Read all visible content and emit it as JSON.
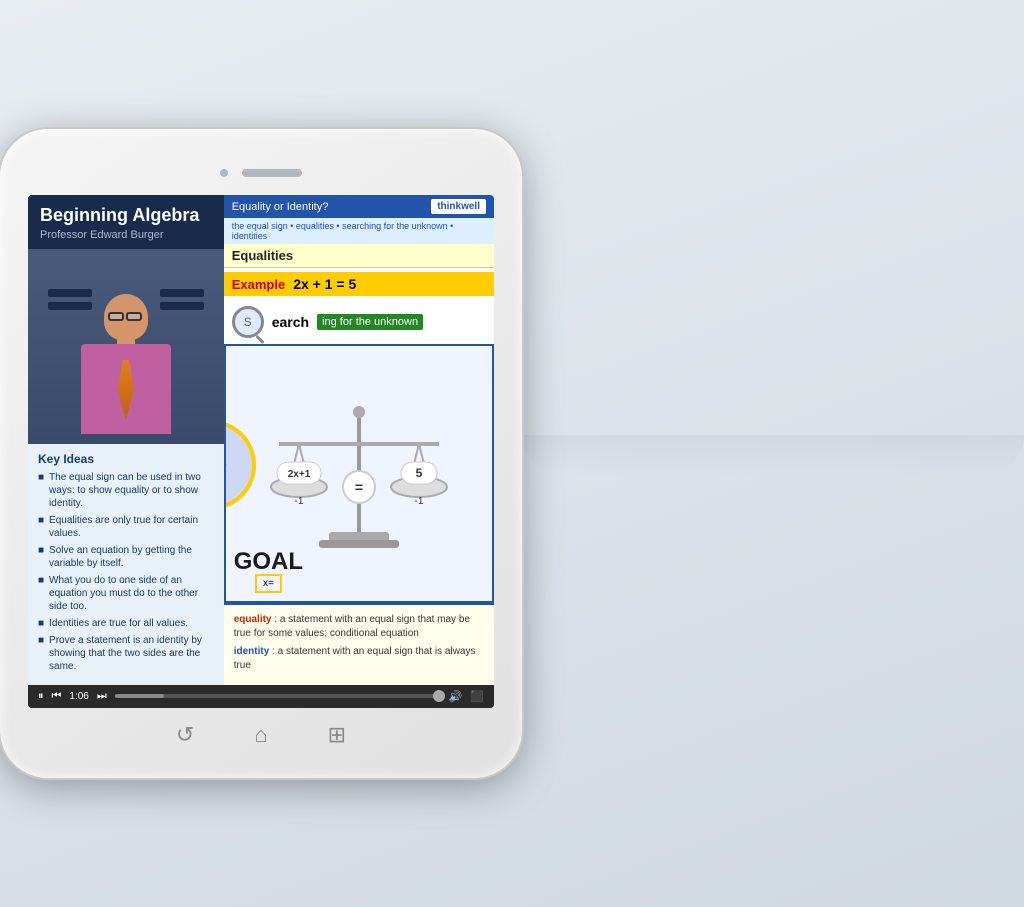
{
  "tablet": {
    "top_bar": {
      "camera_label": "camera",
      "speaker_label": "speaker"
    }
  },
  "left_panel": {
    "title": "Beginning Algebra",
    "subtitle": "Professor Edward Burger",
    "key_ideas_title": "Key Ideas",
    "key_ideas": [
      "The equal sign can be used in two ways: to show equality or to show identity.",
      "Equalities are only true for certain values.",
      "Solve an equation by getting the variable by itself.",
      "What you do to one side of an equation you must do to the other side too.",
      "Identities are true for all values.",
      "Prove a statement is an identity by showing that the two sides are the same."
    ]
  },
  "right_panel": {
    "top_title": "Equality or Identity?",
    "logo": "thinkwell",
    "breadcrumb": "the equal sign  •  equalities  •  searching for the unknown  •  identities",
    "equalities_title": "Equalities",
    "example_label": "Example",
    "example_equation": "2x + 1 = 5",
    "search_text": "Search",
    "search_highlight": "ing for the unknown",
    "goal_text": "GOAL",
    "goal_sub": "x=",
    "scale_left_top": "2x+1",
    "scale_left_bottom": "-1",
    "scale_eq": "=",
    "scale_right_top": "5",
    "scale_right_bottom": "-1",
    "def_equality_term": "equality",
    "def_equality_text": ": a statement with an equal sign that may be true for some values; conditional equation",
    "def_identity_term": "identity",
    "def_identity_text": ": a statement with an equal sign that is always true"
  },
  "controls": {
    "play_pause": "⏸",
    "step_back": "⏮",
    "time": "1:06",
    "step_forward": "⏭",
    "volume": "🔊",
    "fullscreen": "⬛"
  },
  "bottom_nav": {
    "refresh_icon": "↺",
    "home_icon": "⌂",
    "grid_icon": "⊞"
  }
}
